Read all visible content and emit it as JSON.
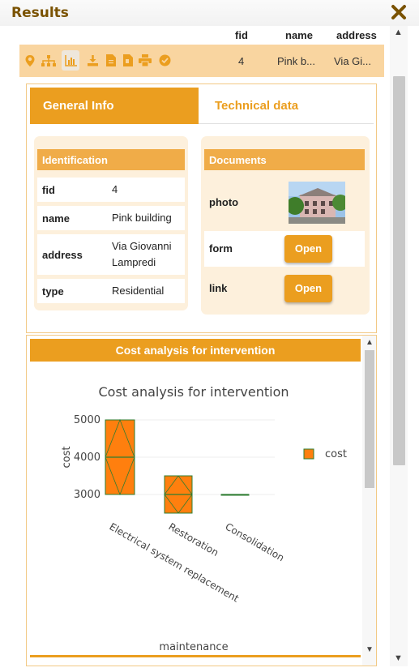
{
  "window": {
    "title": "Results"
  },
  "results": {
    "columns": [
      "fid",
      "name",
      "address"
    ],
    "row": {
      "fid": "4",
      "name": "Pink b...",
      "address": "Via Gi..."
    },
    "toolbar_icons": [
      "marker-icon",
      "hierarchy-icon",
      "chart-icon",
      "download-icon",
      "document-icon",
      "document-alt-icon",
      "print-icon",
      "check-circle-icon"
    ]
  },
  "tabs": [
    {
      "label": "General Info",
      "active": true
    },
    {
      "label": "Technical data",
      "active": false
    }
  ],
  "identification": {
    "heading": "Identification",
    "rows": [
      {
        "key": "fid",
        "value": "4"
      },
      {
        "key": "name",
        "value": "Pink building"
      },
      {
        "key": "address",
        "value": "Via Giovanni Lampredi"
      },
      {
        "key": "type",
        "value": "Residential"
      }
    ]
  },
  "documents": {
    "heading": "Documents",
    "photo_label": "photo",
    "form_label": "form",
    "form_button": "Open",
    "link_label": "link",
    "link_button": "Open"
  },
  "chart_panel": {
    "heading": "Cost analysis for intervention"
  },
  "chart_data": {
    "type": "box",
    "title": "Cost analysis for intervention",
    "xlabel": "maintenance",
    "ylabel": "cost",
    "yticks": [
      3000,
      4000,
      5000
    ],
    "ylim": [
      2700,
      5100
    ],
    "legend": [
      "cost"
    ],
    "legend_position": "top-right",
    "categories": [
      "Electrical system replacement",
      "Restoration",
      "Consolidation"
    ],
    "boxes": [
      {
        "category": "Electrical system replacement",
        "q1": 3000,
        "median": 4000,
        "q3": 5000
      },
      {
        "category": "Restoration",
        "q1": 2500,
        "median": 3000,
        "q3": 3500
      },
      {
        "category": "Consolidation",
        "q1": 3000,
        "median": 3000,
        "q3": 3000
      }
    ],
    "colors": {
      "box_fill": "#ff7f0e",
      "box_line": "#2e7d32"
    }
  },
  "colors": {
    "accent": "#eb9e1f",
    "row_highlight": "#f9d5a0",
    "panel_bg": "#fdf0dc",
    "title": "#7a5200"
  }
}
